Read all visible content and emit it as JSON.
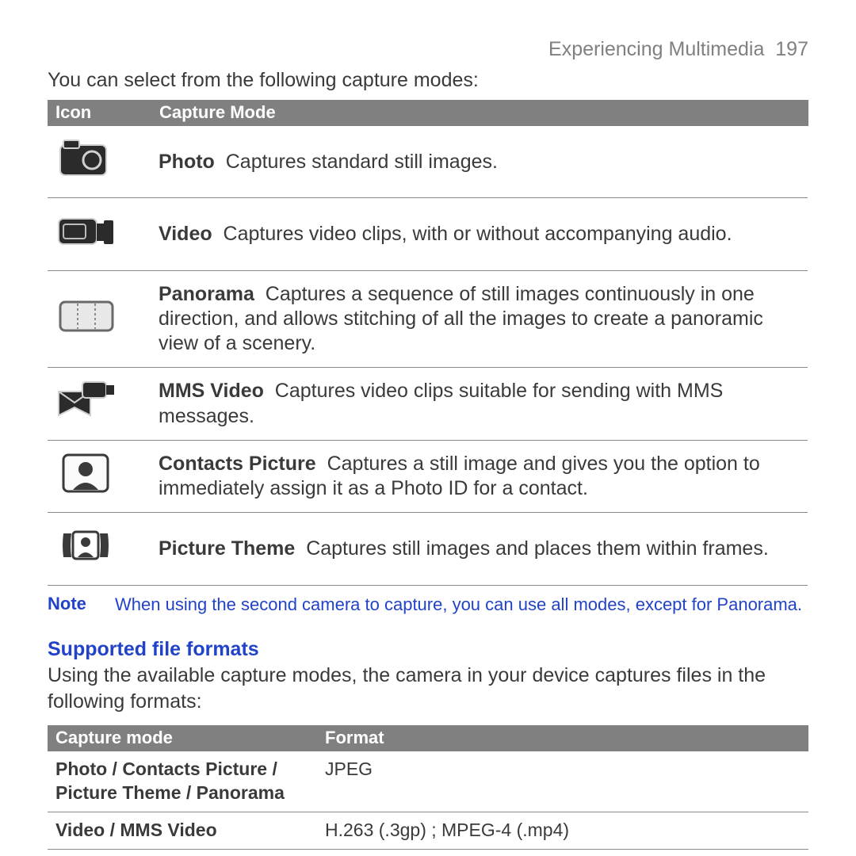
{
  "header": {
    "section": "Experiencing Multimedia",
    "page": "197"
  },
  "intro": "You can select from the following capture modes:",
  "modes_table": {
    "headers": {
      "icon": "Icon",
      "mode": "Capture Mode"
    },
    "rows": [
      {
        "icon": "photo",
        "name": "Photo",
        "desc": "Captures standard still images."
      },
      {
        "icon": "video",
        "name": "Video",
        "desc": "Captures video clips, with or without accompanying audio."
      },
      {
        "icon": "panorama",
        "name": "Panorama",
        "desc": "Captures a sequence of still images continuously in one direction, and allows stitching of all the images to create a panoramic view of a scenery."
      },
      {
        "icon": "mms-video",
        "name": "MMS Video",
        "desc": "Captures video clips suitable for sending with MMS messages."
      },
      {
        "icon": "contacts-pic",
        "name": "Contacts Picture",
        "desc": "Captures a still image and gives you the option to immediately assign it as a Photo ID for a contact."
      },
      {
        "icon": "picture-theme",
        "name": "Picture Theme",
        "desc": "Captures still images and places them within frames."
      }
    ]
  },
  "note": {
    "label": "Note",
    "text": "When using the second camera to capture, you can use all modes, except for Panorama."
  },
  "formats_section": {
    "heading": "Supported file formats",
    "intro": "Using the available capture modes, the camera in your device captures files in the following formats:",
    "headers": {
      "mode": "Capture mode",
      "format": "Format"
    },
    "rows": [
      {
        "mode": "Photo / Contacts Picture / Picture Theme / Panorama",
        "format": "JPEG"
      },
      {
        "mode": "Video / MMS Video",
        "format": "H.263 (.3gp) ; MPEG-4 (.mp4)"
      }
    ]
  }
}
